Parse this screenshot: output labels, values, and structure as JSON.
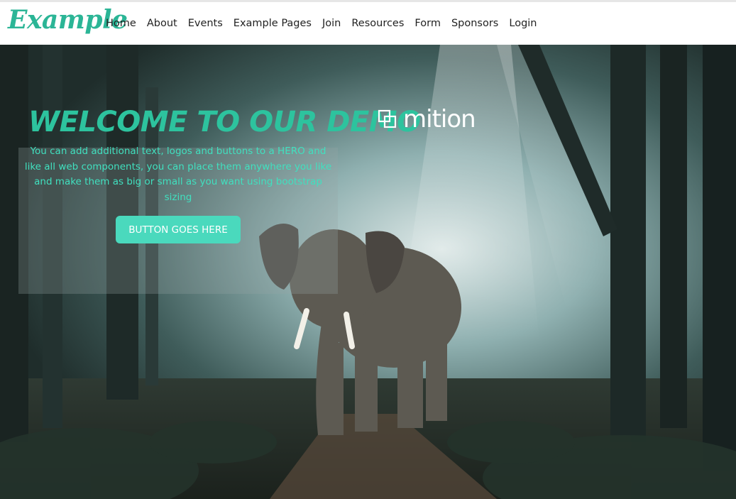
{
  "brand": {
    "logo_text": "Example"
  },
  "nav": {
    "items": [
      "Home",
      "About",
      "Events",
      "Example Pages",
      "Join",
      "Resources",
      "Form",
      "Sponsors",
      "Login"
    ]
  },
  "hero": {
    "title": "Welcome to our Demo",
    "text": "You can add additional text, logos and buttons to a HERO and like all web components, you can place them anywhere you like and make them as big or small as you want using bootstrap sizing",
    "button_label": "BUTTON GOES HERE",
    "partner_logo_text": "mition",
    "background": "elephant walking on a misty forest path"
  },
  "colors": {
    "accent": "#2bb596",
    "hero_text": "#40e0bf",
    "button": "#4ad9bd"
  }
}
